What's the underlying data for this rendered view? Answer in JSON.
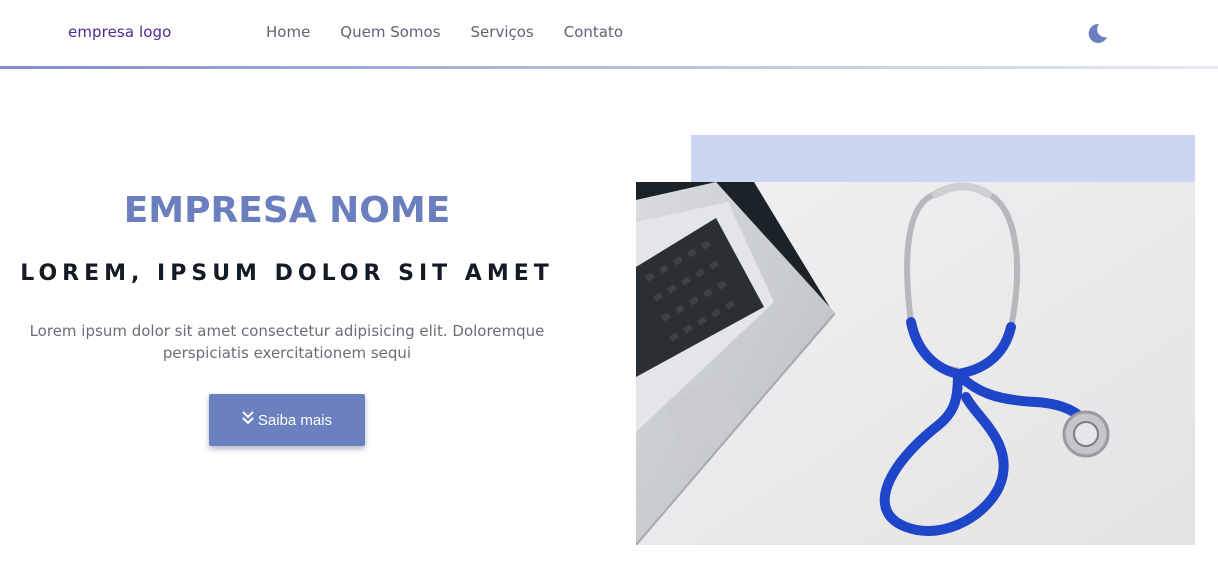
{
  "navbar": {
    "logo": "empresa logo",
    "links": [
      {
        "label": "Home"
      },
      {
        "label": "Quem Somos"
      },
      {
        "label": "Serviços"
      },
      {
        "label": "Contato"
      }
    ],
    "theme_toggle_icon": "moon-icon"
  },
  "hero": {
    "title": "EMPRESA NOME",
    "tagline": "LOREM, IPSUM DOLOR SIT AMET",
    "description": "Lorem ipsum dolor sit amet consectetur adipisicing elit. Doloremque perspiciatis exercitationem sequi",
    "cta": {
      "label": "Saiba mais",
      "icon": "double-chevron-down-icon"
    },
    "image_subject": "laptop-and-stethoscope"
  },
  "colors": {
    "accent": "#6b80bf",
    "logo": "#4b2a8f",
    "accent_light": "#cbd6f2",
    "stethoscope": "#1f45c9"
  }
}
